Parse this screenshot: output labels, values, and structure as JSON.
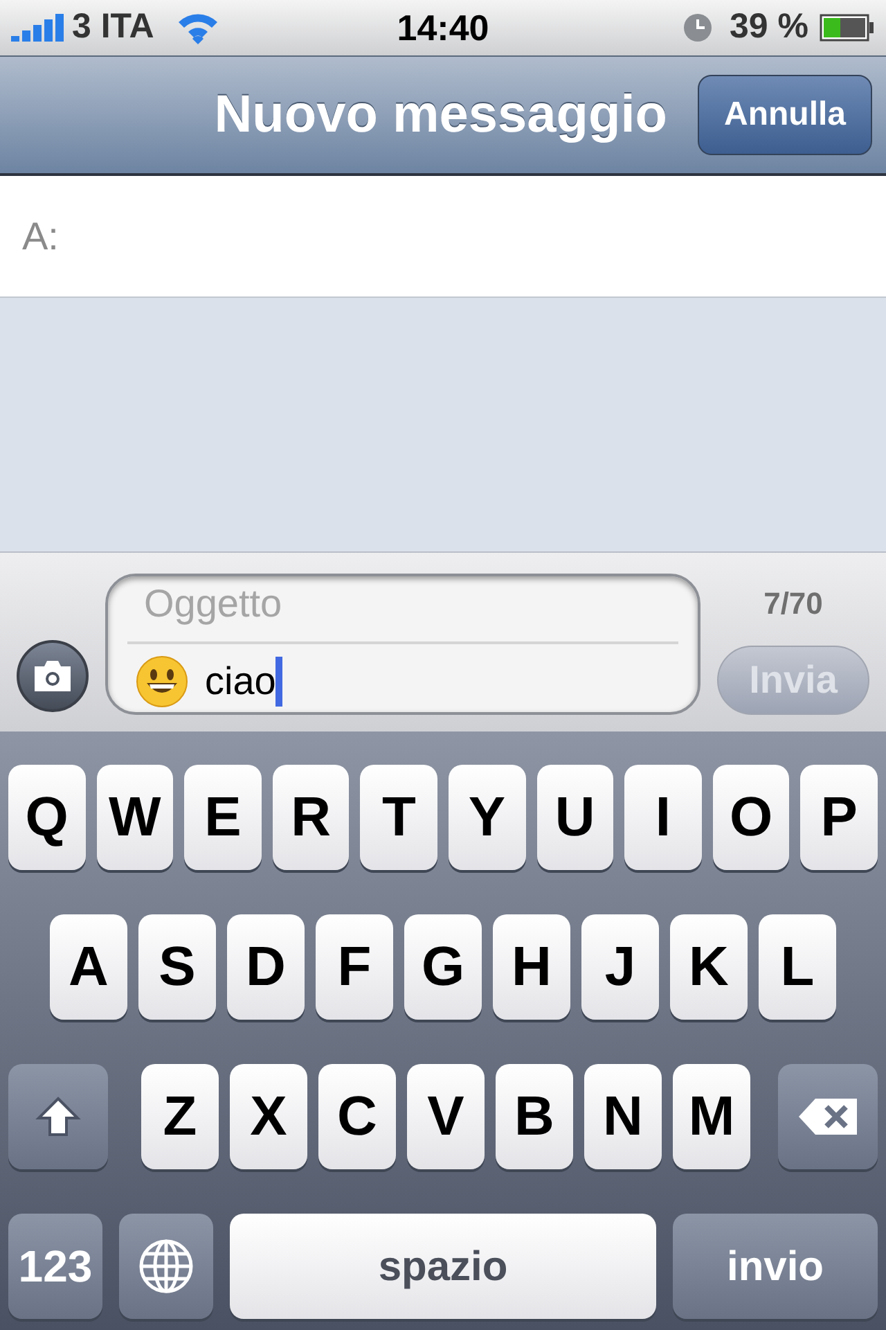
{
  "status_bar": {
    "carrier": "3 ITA",
    "time": "14:40",
    "battery": "39 %"
  },
  "nav_bar": {
    "title": "Nuovo messaggio",
    "cancel_button": "Annulla"
  },
  "recipient": {
    "label": "A:"
  },
  "compose": {
    "subject_placeholder": "Oggetto",
    "message": "ciao",
    "counter": "7/70",
    "send_button": {
      "label": "Invia",
      "disabled": true
    }
  },
  "keyboard": {
    "rows": [
      [
        {
          "kind": "letter",
          "label": "Q"
        },
        {
          "kind": "letter",
          "label": "W"
        },
        {
          "kind": "letter",
          "label": "E"
        },
        {
          "kind": "letter",
          "label": "R"
        },
        {
          "kind": "letter",
          "label": "T"
        },
        {
          "kind": "letter",
          "label": "Y"
        },
        {
          "kind": "letter",
          "label": "U"
        },
        {
          "kind": "letter",
          "label": "I"
        },
        {
          "kind": "letter",
          "label": "O"
        },
        {
          "kind": "letter",
          "label": "P"
        }
      ],
      [
        {
          "kind": "letter",
          "label": "A"
        },
        {
          "kind": "letter",
          "label": "S"
        },
        {
          "kind": "letter",
          "label": "D"
        },
        {
          "kind": "letter",
          "label": "F"
        },
        {
          "kind": "letter",
          "label": "G"
        },
        {
          "kind": "letter",
          "label": "H"
        },
        {
          "kind": "letter",
          "label": "J"
        },
        {
          "kind": "letter",
          "label": "K"
        },
        {
          "kind": "letter",
          "label": "L"
        }
      ],
      [
        {
          "kind": "shift"
        },
        {
          "kind": "letter",
          "label": "Z"
        },
        {
          "kind": "letter",
          "label": "X"
        },
        {
          "kind": "letter",
          "label": "C"
        },
        {
          "kind": "letter",
          "label": "V"
        },
        {
          "kind": "letter",
          "label": "B"
        },
        {
          "kind": "letter",
          "label": "N"
        },
        {
          "kind": "letter",
          "label": "M"
        },
        {
          "kind": "delete"
        }
      ]
    ],
    "bottom_row": {
      "numbers_key": "123",
      "space_key": "spazio",
      "return_key": "invio"
    }
  }
}
